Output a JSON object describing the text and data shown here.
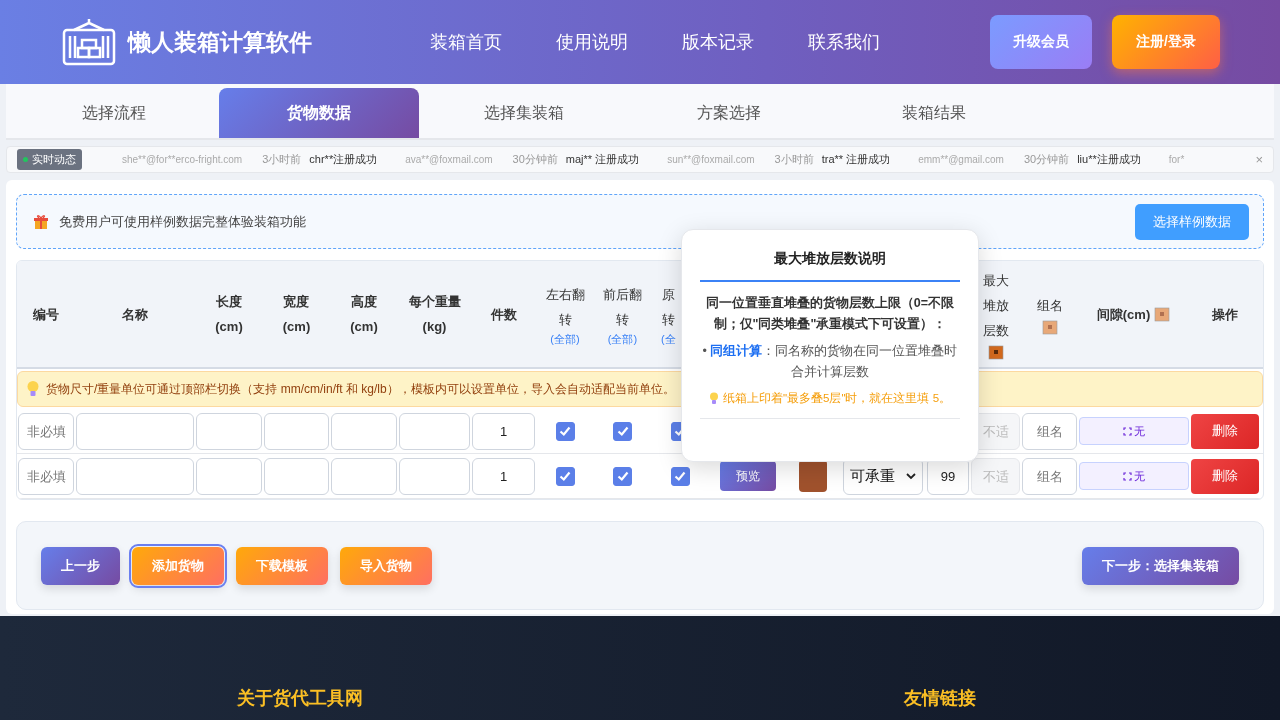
{
  "header": {
    "title": "懒人装箱计算软件",
    "nav": [
      "装箱首页",
      "使用说明",
      "版本记录",
      "联系我们"
    ],
    "buttons": [
      {
        "label": "升级会员",
        "kind": "member"
      },
      {
        "label": "注册/登录",
        "kind": "login"
      }
    ]
  },
  "steps": [
    {
      "label": "选择流程",
      "selected": false
    },
    {
      "label": "货物数据",
      "selected": true
    },
    {
      "label": "选择集装箱",
      "selected": false
    },
    {
      "label": "方案选择",
      "selected": false
    },
    {
      "label": "装箱结果",
      "selected": false
    }
  ],
  "ticker": {
    "badge": "实时动态",
    "items": [
      {
        "text": "she**@for**erco-fright.com",
        "kind": "email"
      },
      {
        "text": "3小时前",
        "kind": "time"
      },
      {
        "text": "chr**注册成功",
        "kind": "event"
      },
      {
        "text": "ava**@foxmail.com",
        "kind": "email"
      },
      {
        "text": "30分钟前",
        "kind": "time"
      },
      {
        "text": "maj** 注册成功",
        "kind": "event"
      },
      {
        "text": "sun**@foxmail.com",
        "kind": "email"
      },
      {
        "text": "3小时前",
        "kind": "time"
      },
      {
        "text": "tra** 注册成功",
        "kind": "event"
      },
      {
        "text": "emm**@gmail.com",
        "kind": "email"
      },
      {
        "text": "30分钟前",
        "kind": "time"
      },
      {
        "text": "liu**注册成功",
        "kind": "event"
      },
      {
        "text": "for*",
        "kind": "email"
      }
    ],
    "close": "×"
  },
  "notice": {
    "text": "免费用户可使用样例数据完整体验装箱功能",
    "button": "选择样例数据"
  },
  "table": {
    "columns": [
      {
        "lines": [
          "编号"
        ]
      },
      {
        "lines": [
          "名称"
        ]
      },
      {
        "lines": [
          "长度",
          "(cm)"
        ]
      },
      {
        "lines": [
          "宽度",
          "(cm)"
        ]
      },
      {
        "lines": [
          "高度",
          "(cm)"
        ]
      },
      {
        "lines": [
          "每个重量",
          "(kg)"
        ]
      },
      {
        "lines": [
          "件数"
        ]
      },
      {
        "lines": [
          "左右翻",
          "转"
        ],
        "sub": "(全部)"
      },
      {
        "lines": [
          "前后翻",
          "转"
        ],
        "sub": "(全部)"
      },
      {
        "lines": [
          "原",
          "转"
        ],
        "sub": "(全",
        "kind": "clipped"
      },
      {
        "kind": "covered"
      },
      {
        "kind": "covered"
      },
      {
        "kind": "covered"
      },
      {
        "kind": "covered"
      },
      {
        "lines": [
          "最大",
          "堆放",
          "层数"
        ],
        "kind": "layers"
      },
      {
        "lines": [
          "组名"
        ],
        "kind": "group"
      },
      {
        "lines": [
          "间隙(cm)"
        ],
        "kind": "gap"
      },
      {
        "lines": [
          "操作"
        ]
      }
    ],
    "hint": "货物尺寸/重量单位可通过顶部栏切换（支持 mm/cm/in/ft 和 kg/lb），模板内可以设置单位，导入会自动适配当前单位。",
    "rows": [
      {
        "cells": [
          {
            "kind": "input",
            "placeholder": "非必填"
          },
          {
            "kind": "input"
          },
          {
            "kind": "input"
          },
          {
            "kind": "input"
          },
          {
            "kind": "input"
          },
          {
            "kind": "input"
          },
          {
            "kind": "input",
            "value": "1"
          },
          {
            "kind": "checkbox",
            "checked": true
          },
          {
            "kind": "checkbox",
            "checked": true
          },
          {
            "kind": "checkbox",
            "checked": true
          },
          {
            "kind": "covered"
          },
          {
            "kind": "covered"
          },
          {
            "kind": "covered"
          },
          {
            "kind": "covered"
          },
          {
            "kind": "input",
            "placeholder": "不适",
            "disabled": true
          },
          {
            "kind": "input",
            "placeholder": "组名"
          },
          {
            "kind": "gap",
            "label": "无"
          },
          {
            "kind": "delete",
            "label": "删除"
          }
        ]
      },
      {
        "cells": [
          {
            "kind": "input",
            "placeholder": "非必填"
          },
          {
            "kind": "input"
          },
          {
            "kind": "input"
          },
          {
            "kind": "input"
          },
          {
            "kind": "input"
          },
          {
            "kind": "input"
          },
          {
            "kind": "input",
            "value": "1"
          },
          {
            "kind": "checkbox",
            "checked": true
          },
          {
            "kind": "checkbox",
            "checked": true
          },
          {
            "kind": "checkbox",
            "checked": true
          },
          {
            "kind": "preview",
            "label": "预览"
          },
          {
            "kind": "swatch",
            "color": "#a0522d"
          },
          {
            "kind": "select",
            "value": "可承重"
          },
          {
            "kind": "input",
            "value": "99"
          },
          {
            "kind": "input",
            "placeholder": "不适",
            "disabled": true
          },
          {
            "kind": "input",
            "placeholder": "组名"
          },
          {
            "kind": "gap",
            "label": "无"
          },
          {
            "kind": "delete",
            "label": "删除"
          }
        ]
      }
    ]
  },
  "popup": {
    "title": "最大堆放层数说明",
    "body": "同一位置垂直堆叠的货物层数上限（0=不限制；仅\"同类堆叠\"承重模式下可设置）：",
    "bullet": "•",
    "bullet_label": "同组计算",
    "bullet_text": "：同名称的货物在同一位置堆叠时合并计算层数",
    "tip": "纸箱上印着\"最多叠5层\"时，就在这里填 5。"
  },
  "actions": [
    {
      "label": "上一步",
      "kind": "back",
      "selected": false
    },
    {
      "label": "添加货物",
      "kind": "orange",
      "selected": true
    },
    {
      "label": "下载模板",
      "kind": "orange",
      "selected": false
    },
    {
      "label": "导入货物",
      "kind": "orange",
      "selected": false
    },
    {
      "label": "下一步：选择集装箱",
      "kind": "next",
      "selected": false
    }
  ],
  "footer": {
    "headings": [
      "关于货代工具网",
      "友情链接"
    ]
  }
}
